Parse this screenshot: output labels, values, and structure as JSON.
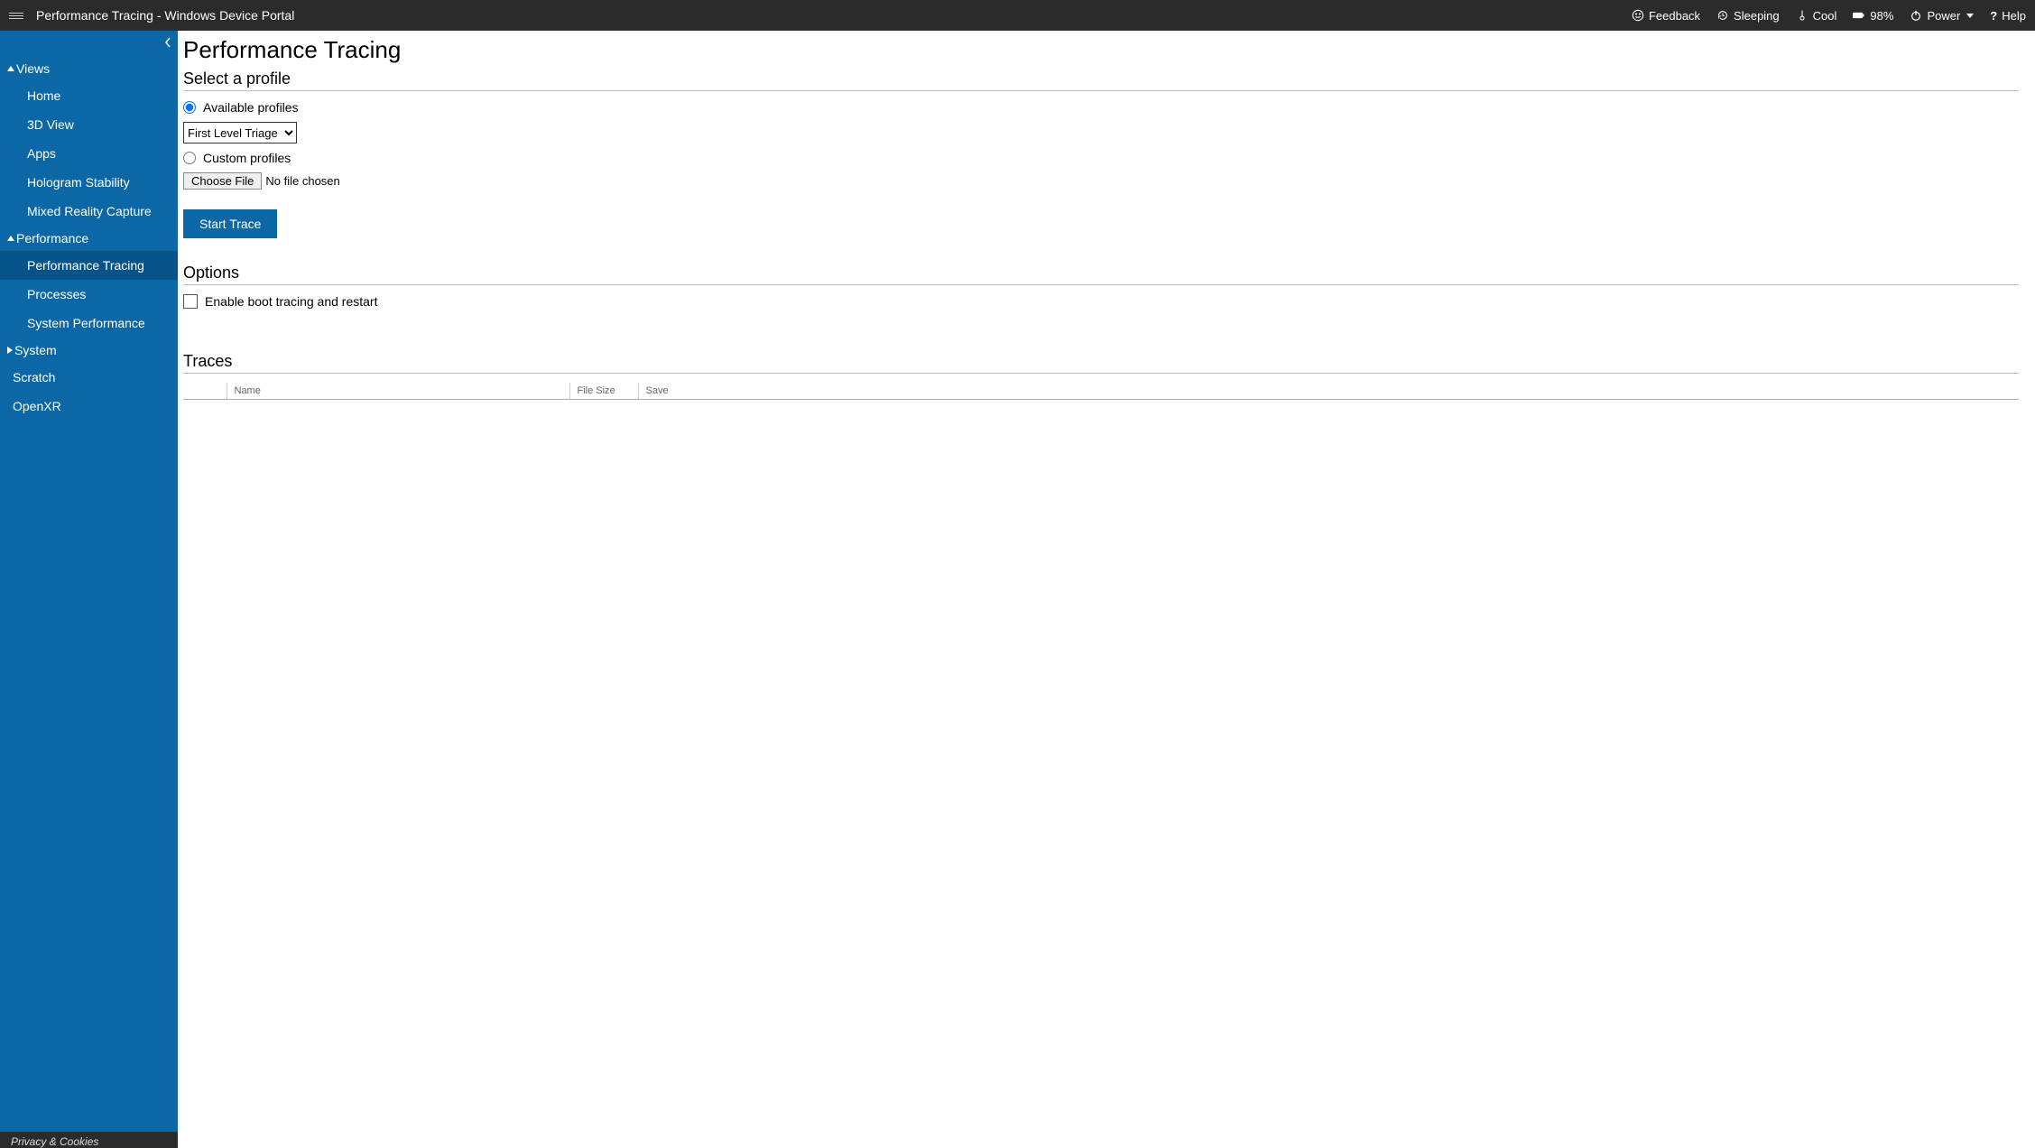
{
  "header": {
    "title": "Performance Tracing - Windows Device Portal",
    "feedback": "Feedback",
    "sleeping": "Sleeping",
    "cool": "Cool",
    "battery": "98%",
    "power": "Power",
    "help": "Help"
  },
  "sidebar": {
    "groups": [
      {
        "label": "Views",
        "expanded": true,
        "items": [
          {
            "label": "Home"
          },
          {
            "label": "3D View"
          },
          {
            "label": "Apps"
          },
          {
            "label": "Hologram Stability"
          },
          {
            "label": "Mixed Reality Capture"
          }
        ]
      },
      {
        "label": "Performance",
        "expanded": true,
        "items": [
          {
            "label": "Performance Tracing",
            "active": true
          },
          {
            "label": "Processes"
          },
          {
            "label": "System Performance"
          }
        ]
      },
      {
        "label": "System",
        "expanded": false,
        "items": []
      }
    ],
    "topItems": [
      {
        "label": "Scratch"
      },
      {
        "label": "OpenXR"
      }
    ],
    "footer": "Privacy & Cookies"
  },
  "main": {
    "pageTitle": "Performance Tracing",
    "selectProfile": "Select a profile",
    "availableProfiles": "Available profiles",
    "profileSelected": "First Level Triage",
    "customProfiles": "Custom profiles",
    "chooseFile": "Choose File",
    "noFile": "No file chosen",
    "startTrace": "Start Trace",
    "options": "Options",
    "enableBoot": "Enable boot tracing and restart",
    "traces": "Traces",
    "tableCols": {
      "name": "Name",
      "fileSize": "File Size",
      "save": "Save"
    }
  }
}
